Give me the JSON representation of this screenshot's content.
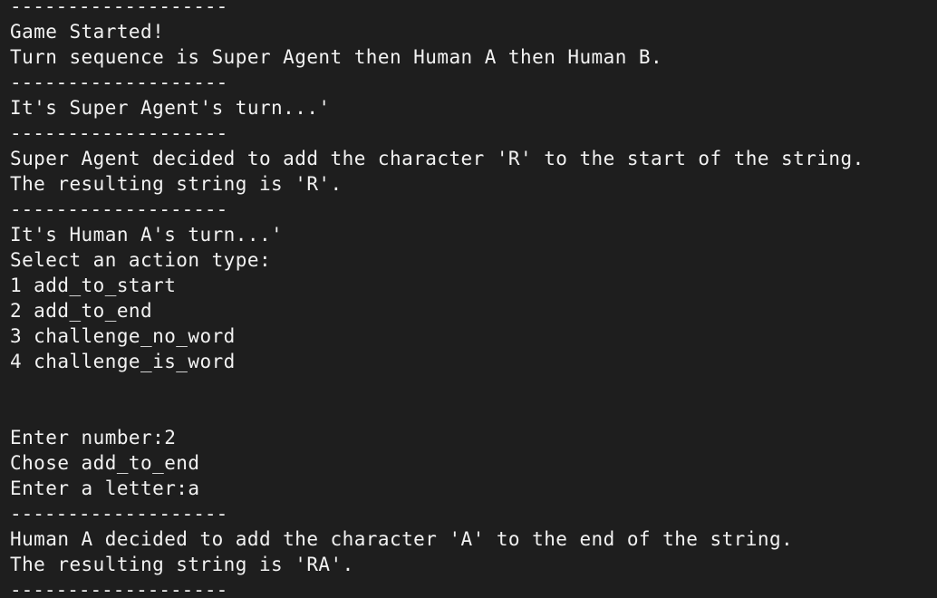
{
  "terminal": {
    "lines": [
      "-------------------",
      "Game Started!",
      "Turn sequence is Super Agent then Human A then Human B.",
      "-------------------",
      "It's Super Agent's turn...'",
      "-------------------",
      "Super Agent decided to add the character 'R' to the start of the string.",
      "The resulting string is 'R'.",
      "-------------------",
      "It's Human A's turn...'",
      "Select an action type:",
      "1 add_to_start",
      "2 add_to_end",
      "3 challenge_no_word",
      "4 challenge_is_word",
      "",
      "",
      "Enter number:2",
      "Chose add_to_end",
      "Enter a letter:a",
      "-------------------",
      "Human A decided to add the character 'A' to the end of the string.",
      "The resulting string is 'RA'.",
      "-------------------"
    ]
  }
}
